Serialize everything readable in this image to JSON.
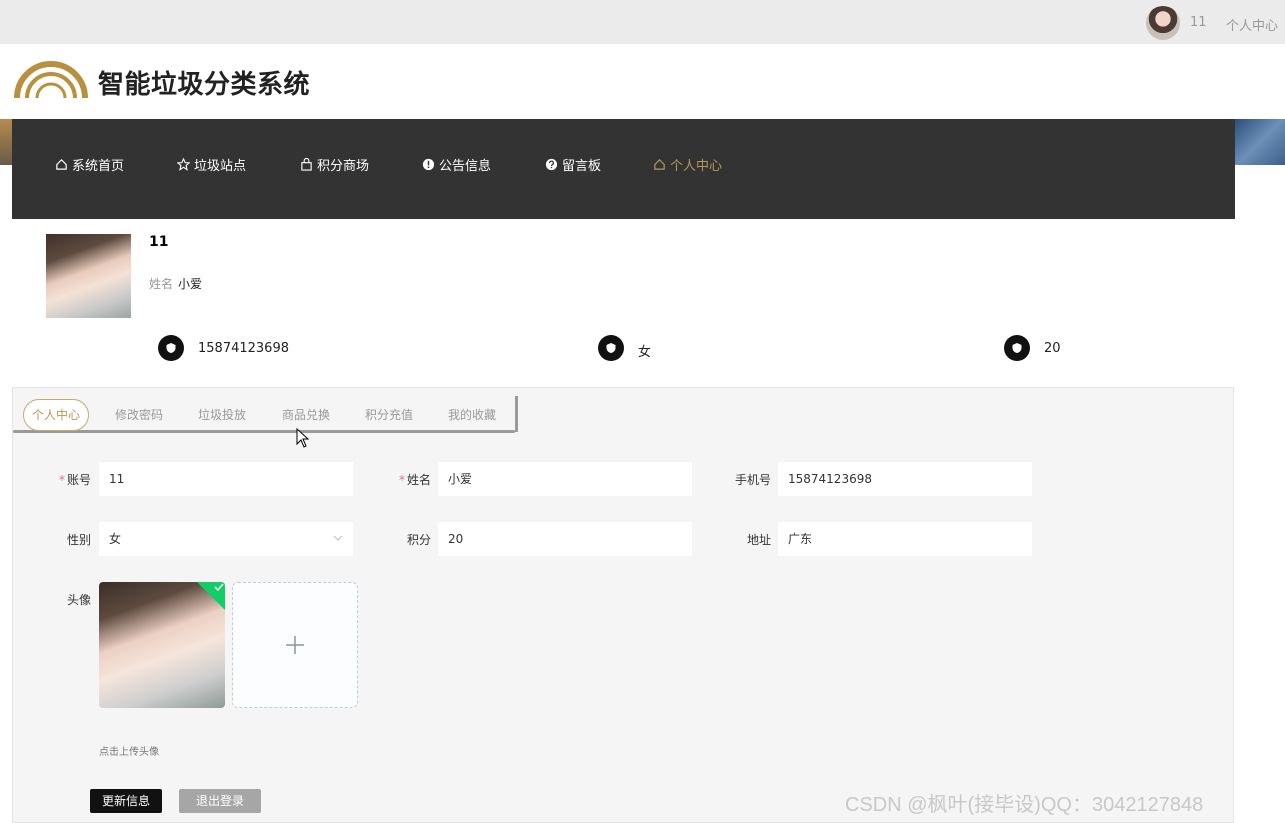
{
  "topbar": {
    "username": "11",
    "center_link": "个人中心"
  },
  "header": {
    "title": "智能垃圾分类系统"
  },
  "nav": {
    "items": [
      {
        "label": "系统首页",
        "icon": "home-icon"
      },
      {
        "label": "垃圾站点",
        "icon": "star-icon"
      },
      {
        "label": "积分商场",
        "icon": "bag-icon"
      },
      {
        "label": "公告信息",
        "icon": "info-icon"
      },
      {
        "label": "留言板",
        "icon": "question-icon"
      },
      {
        "label": "个人中心",
        "icon": "home-icon",
        "active": true
      }
    ],
    "active_color": "#b59a5a"
  },
  "profile": {
    "account": "11",
    "name_label": "姓名",
    "name": "小爱",
    "phone": "15874123698",
    "gender": "女",
    "points": "20"
  },
  "tabs": [
    {
      "label": "个人中心",
      "active": true
    },
    {
      "label": "修改密码"
    },
    {
      "label": "垃圾投放"
    },
    {
      "label": "商品兑换"
    },
    {
      "label": "积分充值"
    },
    {
      "label": "我的收藏"
    }
  ],
  "form": {
    "account_label": "账号",
    "account_value": "11",
    "name_label": "姓名",
    "name_value": "小爱",
    "phone_label": "手机号",
    "phone_value": "15874123698",
    "gender_label": "性别",
    "gender_value": "女",
    "points_label": "积分",
    "points_value": "20",
    "address_label": "地址",
    "address_value": "广东",
    "avatar_label": "头像",
    "upload_tip": "点击上传头像",
    "update_button": "更新信息",
    "logout_button": "退出登录"
  },
  "watermark": "CSDN @枫叶(接毕设)QQ：3042127848",
  "colors": {
    "nav_bg": "#333333",
    "accent_gold": "#b59a5a",
    "required": "#f56c6c",
    "success": "#13ce66"
  }
}
